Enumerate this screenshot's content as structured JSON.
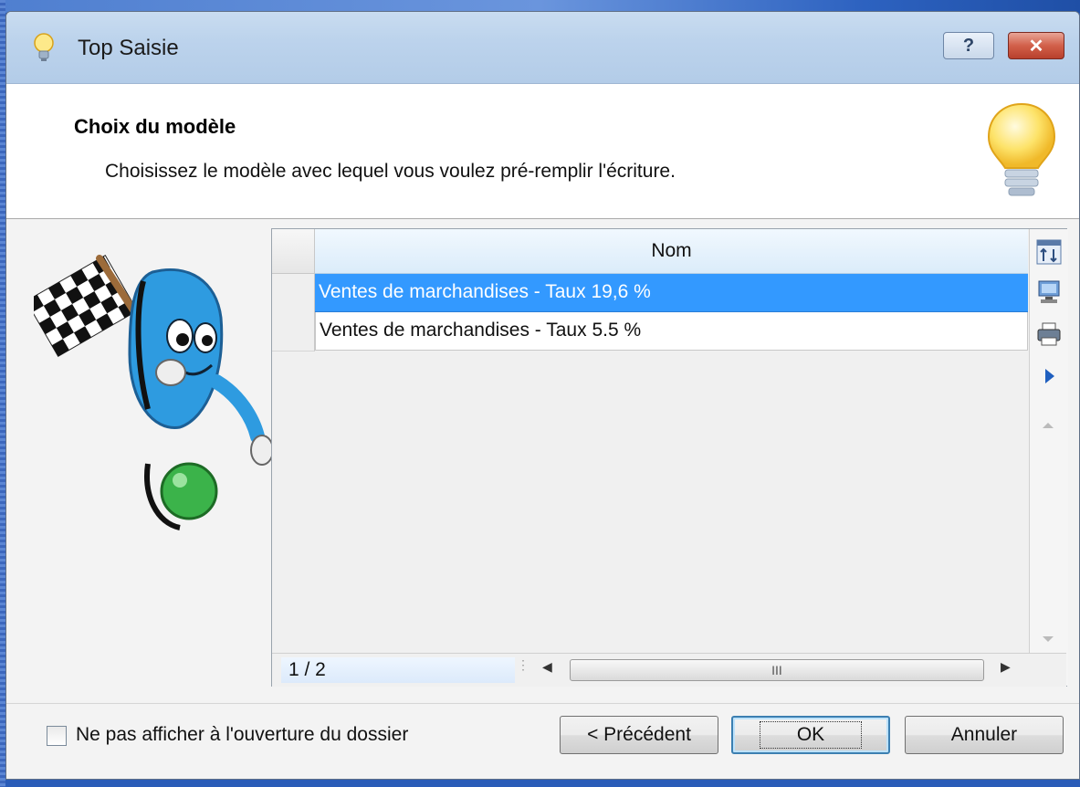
{
  "window": {
    "title": "Top Saisie",
    "help_label": "?",
    "close_label": "✕"
  },
  "header": {
    "title": "Choix du modèle",
    "description": "Choisissez le modèle avec lequel vous voulez pré-remplir l'écriture."
  },
  "grid": {
    "column_header": "Nom",
    "rows": [
      {
        "label": "Ventes de marchandises - Taux 19,6 %",
        "selected": true
      },
      {
        "label": "Ventes de marchandises - Taux 5.5 %",
        "selected": false
      }
    ],
    "counter": "1 / 2",
    "hscroll_grip": "III",
    "tools": [
      "sort-columns-icon",
      "display-icon",
      "print-icon",
      "expand-arrow-icon"
    ]
  },
  "footer": {
    "checkbox_label": "Ne pas afficher à l'ouverture du dossier",
    "checkbox_checked": false,
    "prev_label": "< Précédent",
    "ok_label": "OK",
    "cancel_label": "Annuler"
  },
  "colors": {
    "selection": "#3399ff",
    "close_button": "#c9483a",
    "titlebar": "#bcd3ec"
  }
}
